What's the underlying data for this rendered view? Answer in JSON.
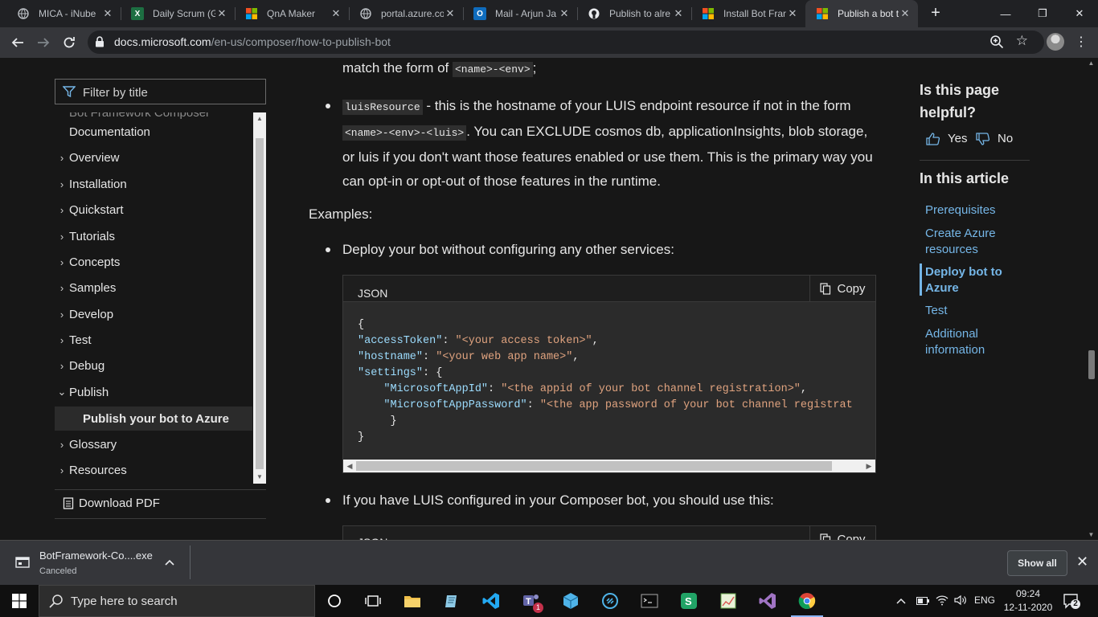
{
  "browser": {
    "tabs": [
      {
        "title": "MICA - iNube",
        "icon": "globe-icon",
        "active": false
      },
      {
        "title": "Daily Scrum (G",
        "icon": "excel-icon",
        "active": false
      },
      {
        "title": "QnA Maker",
        "icon": "microsoft-logo-icon",
        "active": false
      },
      {
        "title": "portal.azure.co",
        "icon": "globe-icon",
        "active": false
      },
      {
        "title": "Mail - Arjun Ja",
        "icon": "outlook-icon",
        "active": false
      },
      {
        "title": "Publish to alre",
        "icon": "github-icon",
        "active": false
      },
      {
        "title": "Install Bot Fran",
        "icon": "microsoft-logo-icon",
        "active": false
      },
      {
        "title": "Publish a bot t",
        "icon": "microsoft-logo-icon",
        "active": true
      }
    ],
    "url_host": "docs.microsoft.com",
    "url_path": "/en-us/composer/how-to-publish-bot"
  },
  "sidebar": {
    "filter_placeholder": "Filter by title",
    "cut_top_label": "Bot Framework Composer",
    "items": [
      {
        "label": "Documentation",
        "chevron": ""
      },
      {
        "label": "Overview",
        "chevron": "›"
      },
      {
        "label": "Installation",
        "chevron": "›"
      },
      {
        "label": "Quickstart",
        "chevron": "›"
      },
      {
        "label": "Tutorials",
        "chevron": "›"
      },
      {
        "label": "Concepts",
        "chevron": "›"
      },
      {
        "label": "Samples",
        "chevron": "›"
      },
      {
        "label": "Develop",
        "chevron": "›"
      },
      {
        "label": "Test",
        "chevron": "›"
      },
      {
        "label": "Debug",
        "chevron": "›"
      },
      {
        "label": "Publish",
        "chevron": "⌄"
      },
      {
        "label": "Publish your bot to Azure",
        "chevron": ""
      },
      {
        "label": "Glossary",
        "chevron": "›"
      },
      {
        "label": "Resources",
        "chevron": "›"
      }
    ],
    "download_pdf": "Download PDF"
  },
  "article": {
    "line1_text": "match the form of ",
    "line1_code": "<name>-<env>",
    "line1_end": ";",
    "bullet1_code": "luisResource",
    "bullet1_text": " - this is the hostname of your LUIS endpoint resource if not in the form",
    "bullet1_code2": "<name>-<env>-<luis>",
    "bullet1_text2": ". You can EXCLUDE cosmos db, applicationInsights, blob storage, or luis if you don't want those features enabled or use them. This is the primary way you can opt-in or opt-out of those features in the runtime.",
    "examples_heading": "Examples:",
    "bullet2_text": "Deploy your bot without configuring any other services:",
    "code1": {
      "lang": "JSON",
      "copy": "Copy",
      "lines": [
        "{",
        "\"accessToken\": \"<your access token>\",",
        "\"hostname\": \"<your web app name>\",",
        "\"settings\": {",
        "    \"MicrosoftAppId\": \"<the appid of your bot channel registration>\",",
        "    \"MicrosoftAppPassword\": \"<the app password of your bot channel registrat",
        "     }",
        "}"
      ]
    },
    "bullet3_text": "If you have LUIS configured in your Composer bot, you should use this:",
    "code2": {
      "lang": "JSON",
      "copy": "Copy"
    }
  },
  "right_rail": {
    "helpful_question": "Is this page helpful?",
    "yes": "Yes",
    "no": "No",
    "in_this_article": "In this article",
    "links": [
      "Prerequisites",
      "Create Azure resources",
      "Deploy bot to Azure",
      "Test",
      "Additional information"
    ],
    "active_link": "Deploy bot to Azure"
  },
  "download_bar": {
    "file_name": "BotFramework-Co....exe",
    "status": "Canceled",
    "show_all": "Show all"
  },
  "taskbar": {
    "search_placeholder": "Type here to search",
    "pinned": [
      "cortana-icon",
      "task-view-icon",
      "file-explorer-icon",
      "notepad-icon",
      "vscode-icon",
      "teams-icon",
      "box-icon",
      "connect-icon",
      "terminal-icon",
      "sheets-icon",
      "chart-app-icon",
      "visual-studio-icon",
      "chrome-icon"
    ],
    "teams_badge": "1",
    "language": "ENG",
    "time": "09:24",
    "date": "12-11-2020",
    "notifications": "2"
  },
  "colors": {
    "accent_link": "#75b6e7",
    "page_bg": "#171717",
    "code_key": "#9cdcfe",
    "code_string": "#e0a37f"
  }
}
